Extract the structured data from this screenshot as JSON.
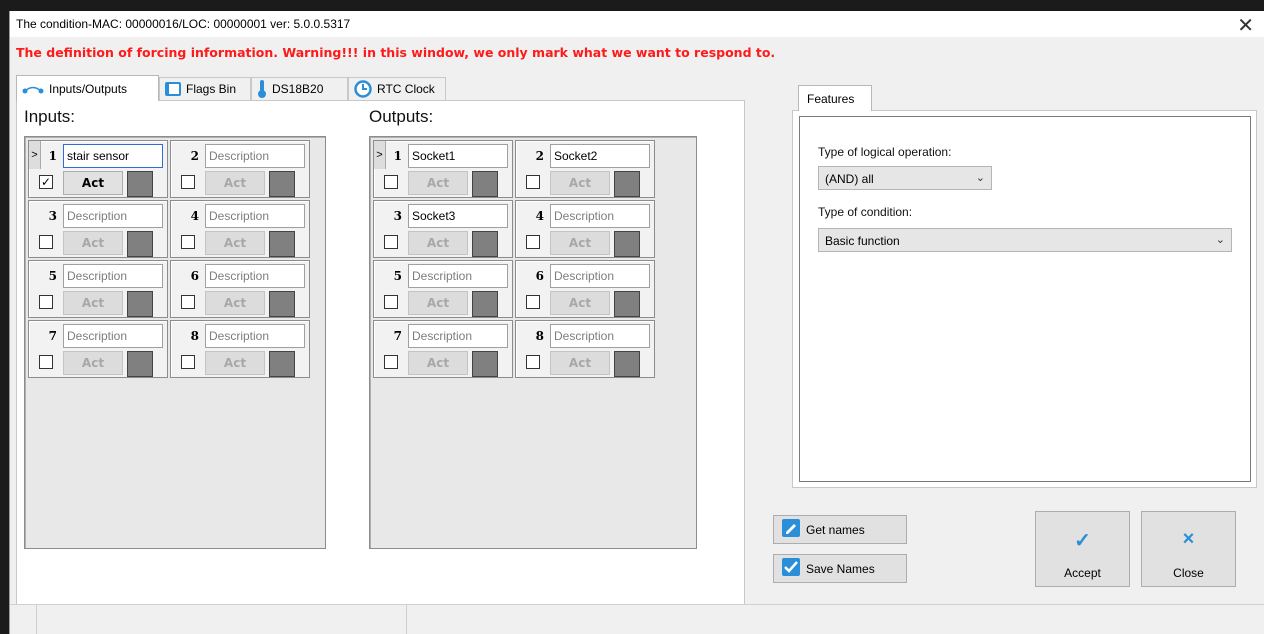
{
  "window": {
    "title": "The condition-MAC: 00000016/LOC: 00000001 ver: 5.0.0.5317",
    "close_glyph": "✕"
  },
  "warning": "The definition of forcing information. Warning!!! in this window, we only mark what we want to respond to.",
  "tabs": [
    {
      "label": "Inputs/Outputs",
      "icon": "io-icon",
      "active": true
    },
    {
      "label": "Flags Bin",
      "icon": "flag-icon",
      "active": false
    },
    {
      "label": "DS18B20",
      "icon": "thermometer-icon",
      "active": false
    },
    {
      "label": "RTC Clock",
      "icon": "clock-icon",
      "active": false
    }
  ],
  "inputs": {
    "title": "Inputs:",
    "expand": ">",
    "items": [
      {
        "num": "1",
        "name": "stair sensor",
        "placeholder": false,
        "checked": true,
        "act": "Act",
        "active": true
      },
      {
        "num": "2",
        "name": "Description",
        "placeholder": true,
        "checked": false,
        "act": "Act",
        "active": false
      },
      {
        "num": "3",
        "name": "Description",
        "placeholder": true,
        "checked": false,
        "act": "Act",
        "active": false
      },
      {
        "num": "4",
        "name": "Description",
        "placeholder": true,
        "checked": false,
        "act": "Act",
        "active": false
      },
      {
        "num": "5",
        "name": "Description",
        "placeholder": true,
        "checked": false,
        "act": "Act",
        "active": false
      },
      {
        "num": "6",
        "name": "Description",
        "placeholder": true,
        "checked": false,
        "act": "Act",
        "active": false
      },
      {
        "num": "7",
        "name": "Description",
        "placeholder": true,
        "checked": false,
        "act": "Act",
        "active": false
      },
      {
        "num": "8",
        "name": "Description",
        "placeholder": true,
        "checked": false,
        "act": "Act",
        "active": false
      }
    ]
  },
  "outputs": {
    "title": "Outputs:",
    "expand": ">",
    "items": [
      {
        "num": "1",
        "name": "Socket1",
        "placeholder": false,
        "checked": false,
        "act": "Act",
        "active": false
      },
      {
        "num": "2",
        "name": "Socket2",
        "placeholder": false,
        "checked": false,
        "act": "Act",
        "active": false
      },
      {
        "num": "3",
        "name": "Socket3",
        "placeholder": false,
        "checked": false,
        "act": "Act",
        "active": false
      },
      {
        "num": "4",
        "name": "Description",
        "placeholder": true,
        "checked": false,
        "act": "Act",
        "active": false
      },
      {
        "num": "5",
        "name": "Description",
        "placeholder": true,
        "checked": false,
        "act": "Act",
        "active": false
      },
      {
        "num": "6",
        "name": "Description",
        "placeholder": true,
        "checked": false,
        "act": "Act",
        "active": false
      },
      {
        "num": "7",
        "name": "Description",
        "placeholder": true,
        "checked": false,
        "act": "Act",
        "active": false
      },
      {
        "num": "8",
        "name": "Description",
        "placeholder": true,
        "checked": false,
        "act": "Act",
        "active": false
      }
    ]
  },
  "features": {
    "tab_label": "Features",
    "logical_label": "Type of logical operation:",
    "logical_value": "(AND) all",
    "condition_label": "Type of condition:",
    "condition_value": "Basic function"
  },
  "buttons": {
    "get_names": "Get names",
    "save_names": "Save Names",
    "accept": "Accept",
    "accept_glyph": "✓",
    "close": "Close",
    "close_glyph": "×"
  },
  "colors": {
    "warning": "#ff1a1a",
    "accent": "#2a8fd8",
    "state_box": "#808080"
  }
}
